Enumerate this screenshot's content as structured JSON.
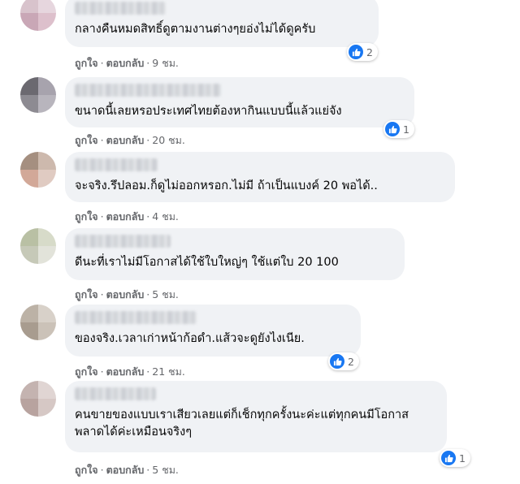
{
  "comment_actions": {
    "like": "ถูกใจ",
    "reply": "ตอบกลับ",
    "separator": "·"
  },
  "comments": [
    {
      "text": "กลางคืนหมดสิทธิ์ดูตามงานต่างๆยอ่งไม่ได้ดูครับ",
      "time": "9 ชม.",
      "reaction_count": "2",
      "avatar_colors": [
        "#d8c3cc",
        "#e6d6de",
        "#c9a7b6",
        "#ddc0cc"
      ]
    },
    {
      "text": "ขนาดนี้เลยหรอประเทศไทยต้องหากินแบบนี้แล้วแย่จัง",
      "time": "20 ชม.",
      "reaction_count": "1",
      "avatar_colors": [
        "#6b6970",
        "#a7a3ad",
        "#8d8b92",
        "#b8b5bd"
      ]
    },
    {
      "text": "จะจริง.รึปลอม.ก็ดูไม่ออกหรอก.ไม่มี ถ้าเป็นแบงค์ 20 พอได้..",
      "time": "4 ชม.",
      "reaction_count": "",
      "avatar_colors": [
        "#a58f80",
        "#cdb9ad",
        "#d2a898",
        "#e0cbc2"
      ]
    },
    {
      "text": "ดีนะที่เราไม่มีโอกาสได้ใช้ใบใหญ่ๆ ใช้แต่ใบ 20 100",
      "time": "5 ชม.",
      "reaction_count": "",
      "avatar_colors": [
        "#b9c0a4",
        "#d7dbc9",
        "#c6c9b8",
        "#e2e3da"
      ]
    },
    {
      "text": "ของจริง.เวลาเก่าหน้าก้อดำ.แส้วจะดูยังไงเนีย.",
      "time": "21 ชม.",
      "reaction_count": "2",
      "avatar_colors": [
        "#bcb2a6",
        "#d8d1c9",
        "#a89c8f",
        "#cbc2b8"
      ]
    },
    {
      "text": "คนขายของแบบเราเสียวเลยแต่ก็เช็กทุกครั้งนะค่ะแต่ทุกคนมีโอกาสพลาดได้ค่ะเหมือนจริงๆ",
      "time": "5 ชม.",
      "reaction_count": "1",
      "avatar_colors": [
        "#c4b3b0",
        "#e0d5d3",
        "#b8a39f",
        "#d6c8c5"
      ]
    }
  ],
  "colors": {
    "bubble": "#f0f2f5",
    "meta": "#65676b",
    "like_blue": "#1877f2"
  }
}
